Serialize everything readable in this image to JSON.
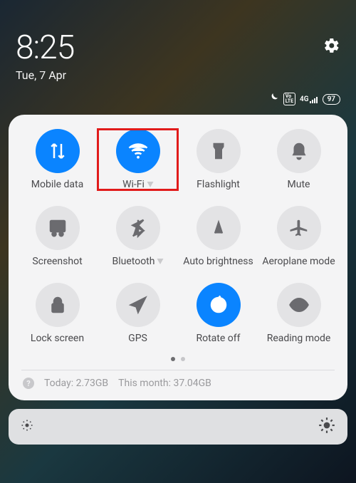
{
  "header": {
    "time": "8:25",
    "date": "Tue, 7 Apr",
    "battery": "97",
    "network_label": "4G"
  },
  "tiles": [
    {
      "label": "Mobile data"
    },
    {
      "label": "Wi-Fi"
    },
    {
      "label": "Flashlight"
    },
    {
      "label": "Mute"
    },
    {
      "label": "Screenshot"
    },
    {
      "label": "Bluetooth"
    },
    {
      "label": "Auto brightness"
    },
    {
      "label": "Aeroplane mode"
    },
    {
      "label": "Lock screen"
    },
    {
      "label": "GPS"
    },
    {
      "label": "Rotate off"
    },
    {
      "label": "Reading mode"
    }
  ],
  "usage": {
    "today_label": "Today:",
    "today_value": "2.73GB",
    "month_label": "This month:",
    "month_value": "37.04GB"
  }
}
